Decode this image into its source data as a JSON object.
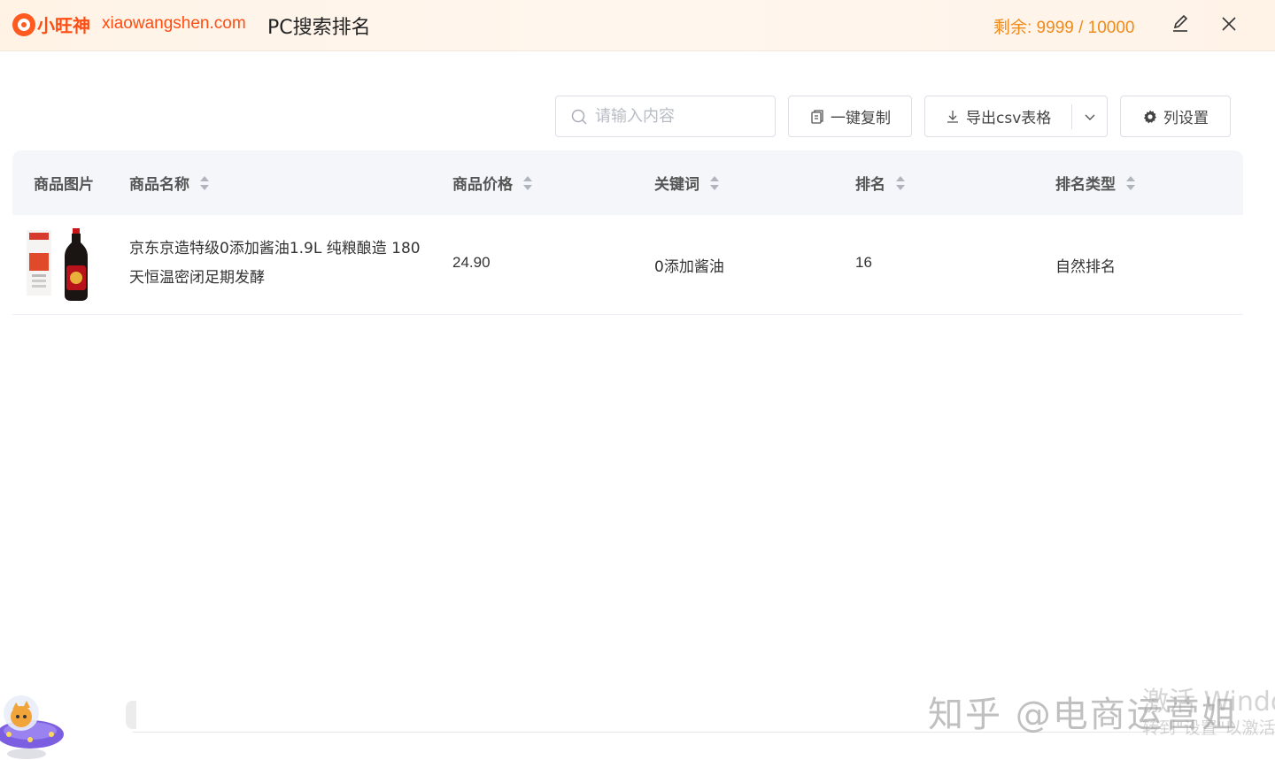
{
  "titlebar": {
    "brand": "小旺神",
    "domain": "xiaowangshen.com",
    "title": "PC搜索排名",
    "quota": "剩余: 9999 / 10000",
    "edit_icon": "pencil-icon",
    "close_icon": "close-icon"
  },
  "toolbar": {
    "search_placeholder": "请输入内容",
    "copy_label": "一键复制",
    "export_label": "导出csv表格",
    "columns_label": "列设置"
  },
  "table": {
    "headers": [
      "商品图片",
      "商品名称",
      "商品价格",
      "关键词",
      "排名",
      "排名类型"
    ],
    "rows": [
      {
        "name": "京东京造特级0添加酱油1.9L 纯粮酿造 180天恒温密闭足期发酵",
        "price": "24.90",
        "keyword": "0添加酱油",
        "rank": "16",
        "rank_type": "自然排名"
      }
    ]
  },
  "overlay": {
    "watermark": "知乎 @电商运营姐",
    "windows_activate": "激活 Windo",
    "windows_activate_sub": "转到\"设置\"以激活"
  },
  "colors": {
    "brand": "#ff4d12",
    "quota": "#f08a1a",
    "header_bg": "#f4f6fa"
  }
}
